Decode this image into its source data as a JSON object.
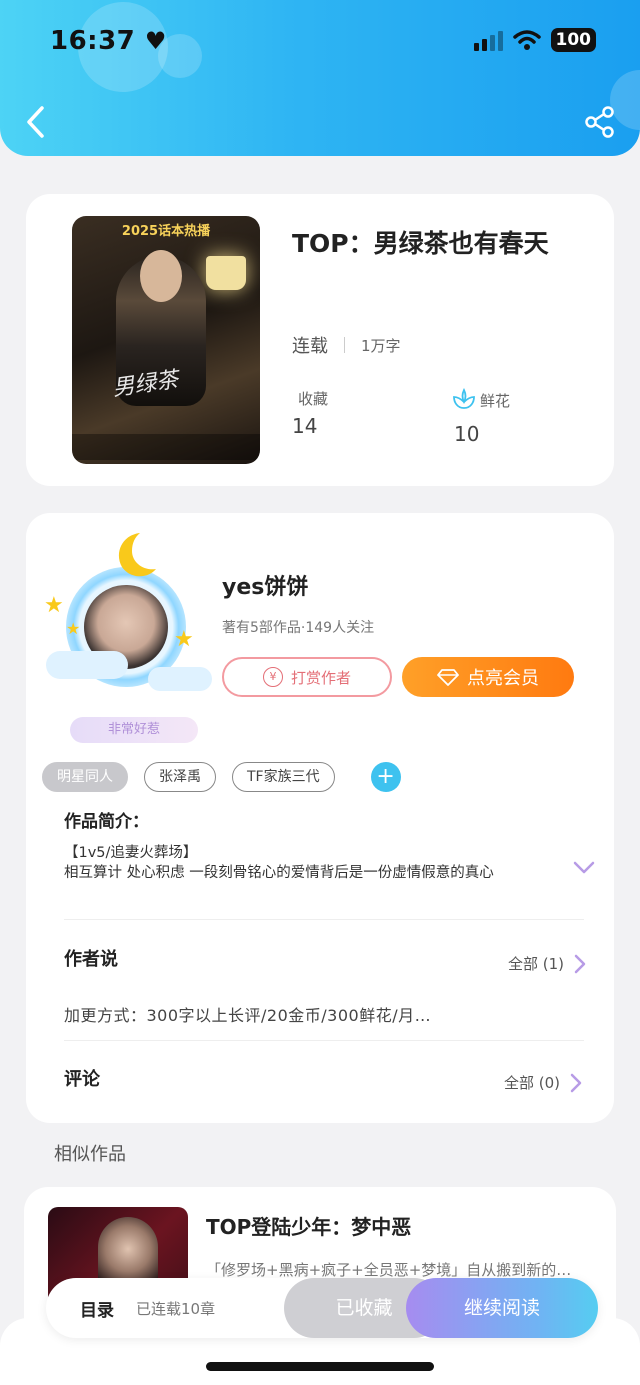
{
  "status_bar": {
    "time": "16:37",
    "battery": "100"
  },
  "book": {
    "title": "TOP：男绿茶也有春天",
    "cover_banner": "2025话本热播",
    "status": "连载",
    "word_count": "1万字",
    "favorites_label": "收藏",
    "favorites_value": "14",
    "flowers_label": "鲜花",
    "flowers_value": "10"
  },
  "author": {
    "name": "yes饼饼",
    "stats": "著有5部作品·149人关注",
    "badge": "非常好惹",
    "tip_button": "打赏作者",
    "vip_button": "点亮会员"
  },
  "tags": [
    "明星同人",
    "张泽禹",
    "TF家族三代"
  ],
  "intro": {
    "title": "作品简介：",
    "line1": "【1v5/追妻火葬场】",
    "line2": "相互算计 处心积虑 一段刻骨铭心的爱情背后是一份虚情假意的真心"
  },
  "author_says": {
    "title": "作者说",
    "link": "全部 (1)",
    "text": "加更方式：300字以上长评/20金币/300鲜花/月…"
  },
  "comments": {
    "title": "评论",
    "link": "全部 (0)"
  },
  "similar": {
    "title": "相似作品",
    "items": [
      {
        "title": "TOP登陆少年：梦中恶",
        "desc": "「修罗场+黑病+疯子+全员恶+梦境」自从搬到新的…"
      }
    ]
  },
  "bottom_bar": {
    "toc": "目录",
    "chapters": "已连载10章",
    "collected": "已收藏",
    "continue": "继续阅读"
  },
  "colors": {
    "header_accent": "#2fb5f3",
    "vip_orange": "#ff8a1a",
    "tip_pink": "#e46f77",
    "continue_gradient_start": "#a68cf0"
  }
}
